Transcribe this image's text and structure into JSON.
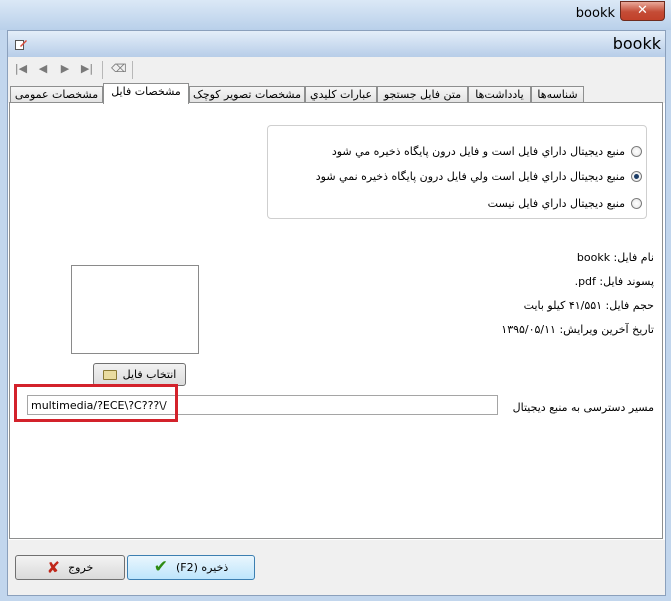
{
  "window": {
    "title": "bookk",
    "close_symbol": "✕"
  },
  "header": {
    "title": "bookk"
  },
  "toolbar": {
    "icons": [
      "first-record-icon",
      "previous-record-icon",
      "next-record-icon",
      "last-record-icon",
      "eraser-icon"
    ],
    "first": "|◀",
    "prev": "◀",
    "next": "▶",
    "last": "▶|",
    "erase": "⌫"
  },
  "tabs": [
    {
      "label": "شناسه‌ها"
    },
    {
      "label": "یادداشت‌ها"
    },
    {
      "label": "متن فایل جستجو"
    },
    {
      "label": "عبارات کلیدي"
    },
    {
      "label": "مشخصات تصوير کوچک"
    },
    {
      "label": "مشخصات فايل",
      "active": true
    },
    {
      "label": "مشخصات عمومی"
    }
  ],
  "radios": [
    {
      "label": "منبع ديجيتال داراي فايل است و فايل درون پايگاه ذخيره مي شود",
      "checked": false
    },
    {
      "label": "منبع ديجيتال داراي فايل است ولي فايل درون پايگاه ذخيره نمي شود",
      "checked": true
    },
    {
      "label": "منبع ديجيتال داراي فايل نيست",
      "checked": false
    }
  ],
  "file_info": {
    "name": "نام فایل: bookk",
    "extension": "پسوند فایل: pdf.",
    "size": "حجم فایل: ۴۱/۵۵۱ کیلو بایت",
    "last_edit": "تاریخ آخرین ویرایش: ۱۳۹۵/۰۵/۱۱"
  },
  "pick_file_button": "انتخاب فایل",
  "path": {
    "label": "مسیر دسترسی به منبع دیجیتال",
    "value": "multimedia/?ECE\\?C???\\/"
  },
  "footer": {
    "save_label": "ذخیره (F2)",
    "exit_label": "خروج"
  },
  "colors": {
    "highlight": "#d3222b",
    "accent": "#3c7fb1"
  }
}
